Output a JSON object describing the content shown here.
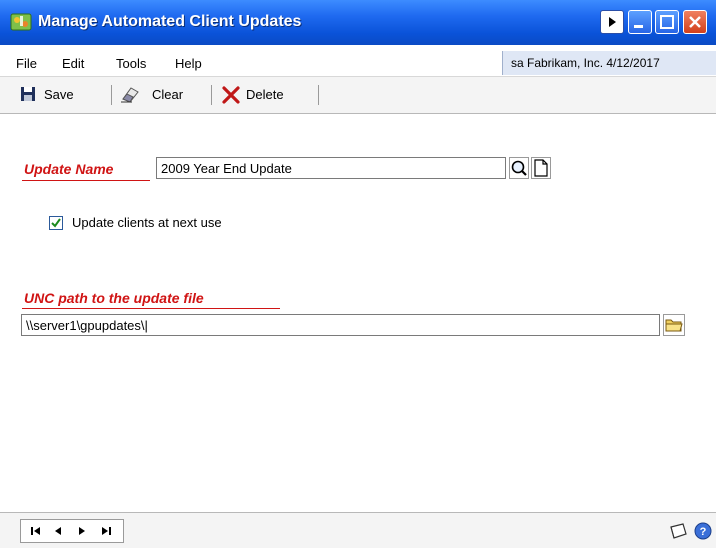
{
  "window": {
    "title": "Manage Automated Client Updates"
  },
  "menu": {
    "items": [
      "File",
      "Edit",
      "Tools",
      "Help"
    ],
    "context": "sa  Fabrikam, Inc.  4/12/2017"
  },
  "toolbar": {
    "save_label": "Save",
    "clear_label": "Clear",
    "delete_label": "Delete"
  },
  "form": {
    "update_name_label": "Update Name",
    "update_name_value": "2009 Year End Update",
    "checkbox_label": "Update clients at next use",
    "checkbox_checked": true,
    "unc_label": "UNC path to the update file",
    "unc_value": "\\\\server1\\gpupdates\\|"
  },
  "colors": {
    "titlebar": "#1f6af0",
    "required_label": "#d01414",
    "context_bg": "#dfe7f5"
  },
  "icons": {
    "app": "app-icon",
    "save": "floppy-disk-icon",
    "clear": "eraser-icon",
    "delete": "red-x-icon",
    "lookup": "magnifier-icon",
    "new": "blank-page-icon",
    "folder": "folder-icon",
    "note": "note-icon",
    "help": "help-icon"
  }
}
